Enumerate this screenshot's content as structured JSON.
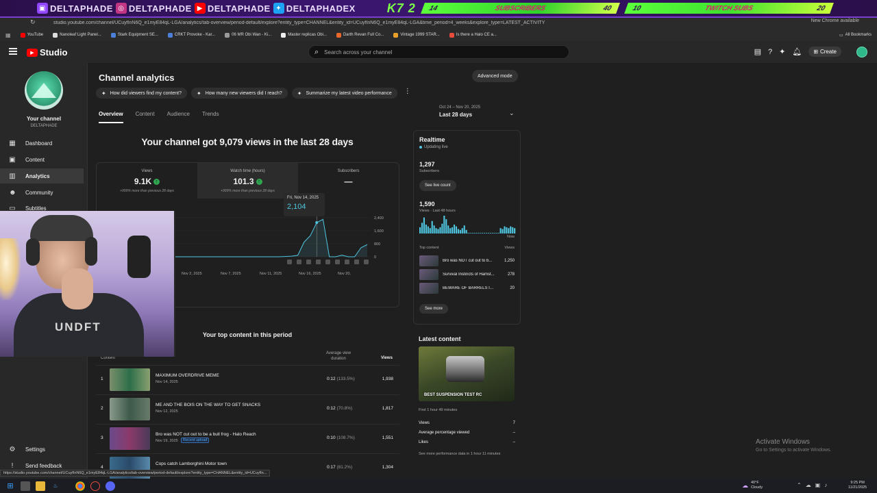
{
  "overlay": {
    "handles": [
      "DELTAPHADE",
      "DELTAPHADE",
      "DELTAPHADE",
      "DELTAPHADEX"
    ],
    "brand": "K7 2",
    "goal_subs": {
      "current": "14",
      "label": "SUBSCRIBERS",
      "target": "40"
    },
    "goal_twitch": {
      "current": "10",
      "label": "TWITCH SUBS",
      "target": "20"
    }
  },
  "browser": {
    "url": "studio.youtube.com/channel/UCuyfInN6Q_e1myE84qL-LGA/analytics/tab-overview/period-default/explore?entity_type=CHANNEL&entity_id=UCuyfInN6Q_e1myE84qL-LGA&time_period=4_weeks&explore_type=LATEST_ACTIVITY",
    "update_label": "New Chrome available",
    "bookmarks": [
      "YouTube",
      "Nanoleaf Light Panel...",
      "Stark Equipment SE...",
      "CRKT Provoke - Kar...",
      "06 MR Obi Wan - Ki...",
      "Master replicas Obi...",
      "Darth Revan Full Co...",
      "Vintage 1999 STAR...",
      "Is there a Halo CE a..."
    ],
    "all_bookmarks": "All Bookmarks"
  },
  "header": {
    "logo": "Studio",
    "search_placeholder": "Search across your channel",
    "create_label": "Create"
  },
  "sidebar": {
    "channel_title": "Your channel",
    "channel_name": "DELTAPHADE",
    "items": [
      {
        "label": "Dashboard",
        "icon": "dashboard-icon"
      },
      {
        "label": "Content",
        "icon": "content-icon"
      },
      {
        "label": "Analytics",
        "icon": "analytics-icon"
      },
      {
        "label": "Community",
        "icon": "community-icon"
      },
      {
        "label": "Subtitles",
        "icon": "subtitles-icon"
      }
    ],
    "settings": "Settings",
    "feedback": "Send feedback"
  },
  "main": {
    "title": "Channel analytics",
    "advanced_mode": "Advanced mode",
    "chips": [
      "How did viewers find my content?",
      "How many new viewers did I reach?",
      "Summarize my latest video performance"
    ],
    "tabs": [
      "Overview",
      "Content",
      "Audience",
      "Trends"
    ],
    "date_range_sub": "Oct 24 – Nov 20, 2025",
    "date_range": "Last 28 days",
    "headline": "Your channel got 9,079 views in the last 28 days",
    "metrics": [
      {
        "label": "Views",
        "value": "9.1K",
        "compare": "+999% more than previous 28 days"
      },
      {
        "label": "Watch time (hours)",
        "value": "101.3",
        "compare": "+999% more than previous 28 days"
      },
      {
        "label": "Subscribers",
        "value": "—",
        "compare": ""
      }
    ],
    "tooltip": {
      "date": "Fri, Nov 14, 2025",
      "value": "2,104"
    },
    "top_content_title": "Your top content in this period",
    "table_headers": {
      "content": "Content",
      "avd": "Average view duration",
      "views": "Views"
    },
    "rows": [
      {
        "rank": "1",
        "title": "MAXIMUM OVERDRIVE MEME",
        "date": "Nov 14, 2025",
        "badge": "",
        "avd": "0:12",
        "pct": "(133.5%)",
        "views": "1,938"
      },
      {
        "rank": "2",
        "title": "ME AND THE BOIS ON THE WAY TO GET SNACKS",
        "date": "Nov 12, 2025",
        "badge": "",
        "avd": "0:12",
        "pct": "(70.8%)",
        "views": "1,817"
      },
      {
        "rank": "3",
        "title": "Bro was NOT cut out to be a bull frog - Halo Reach",
        "date": "Nov 19, 2025",
        "badge": "Recent upload",
        "avd": "0:10",
        "pct": "(108.7%)",
        "views": "1,551"
      },
      {
        "rank": "4",
        "title": "Cops catch Lamborghini Motor town",
        "date": "",
        "badge": "",
        "avd": "0:17",
        "pct": "(81.2%)",
        "views": "1,304"
      }
    ]
  },
  "chart_data": {
    "type": "line",
    "x_tick_labels": [
      "Nov 2, 2025",
      "Nov 7, 2025",
      "Nov 11, 2025",
      "Nov 16, 2025",
      "Nov 20,"
    ],
    "y_tick_labels": [
      "2,400",
      "1,600",
      "800",
      "0"
    ],
    "ylim": [
      0,
      2400
    ],
    "series": [
      {
        "values": [
          0,
          0,
          0,
          0,
          0,
          0,
          0,
          0,
          0,
          0,
          0,
          0,
          0,
          0,
          0,
          0,
          0,
          0,
          0,
          15,
          40,
          90,
          900,
          1300,
          2104,
          2300,
          0,
          0,
          100,
          0,
          0,
          550,
          750
        ]
      }
    ]
  },
  "realtime": {
    "title": "Realtime",
    "updating": "Updating live",
    "subs": "1,297",
    "subs_label": "Subscribers",
    "live_count_btn": "See live count",
    "views48": "1,590",
    "views48_label": "Views · Last 48 hours",
    "now_label": "Now",
    "top_content_label": "Top content",
    "views_label": "Views",
    "bars": [
      0.35,
      0.6,
      0.9,
      0.5,
      0.4,
      0.3,
      0.7,
      0.45,
      0.3,
      0.25,
      0.35,
      0.55,
      1.0,
      0.8,
      0.45,
      0.3,
      0.35,
      0.5,
      0.4,
      0.25,
      0.2,
      0.3,
      0.45,
      0.2,
      0,
      0,
      0,
      0,
      0,
      0,
      0,
      0,
      0,
      0,
      0,
      0,
      0,
      0,
      0,
      0,
      0.3,
      0.25,
      0.4,
      0.35,
      0.3,
      0.4,
      0.35,
      0.3
    ],
    "items": [
      {
        "title": "Bro was NOT cut out to b...",
        "views": "1,250"
      },
      {
        "title": "Survival Instincts of Hamst...",
        "views": "278"
      },
      {
        "title": "BEWARE OF BARRELS IN DA...",
        "views": "20"
      }
    ],
    "see_more": "See more"
  },
  "latest": {
    "title": "Latest content",
    "video_title": "BEST SUSPENSION TEST RC",
    "age": "First 1 hour 49 minutes",
    "stats": [
      {
        "label": "Views",
        "value": "7"
      },
      {
        "label": "Average percentage viewed",
        "value": "–"
      },
      {
        "label": "Likes",
        "value": "–"
      }
    ],
    "note": "See more performance data in 1 hour 11 minutes"
  },
  "windows": {
    "activate": "Activate Windows",
    "activate_sub": "Go to Settings to activate Windows.",
    "temp": "40°F",
    "weather": "Cloudy",
    "time": "9:25 PM",
    "date": "11/21/2025"
  },
  "status_url": "https://studio.youtube.com/channel/UCuyfInN6Q_e1myE84qL-LGA/analytics/tab-overview/period-default/explore?entity_type=CHANNEL&entity_id=UCuyfIn..."
}
